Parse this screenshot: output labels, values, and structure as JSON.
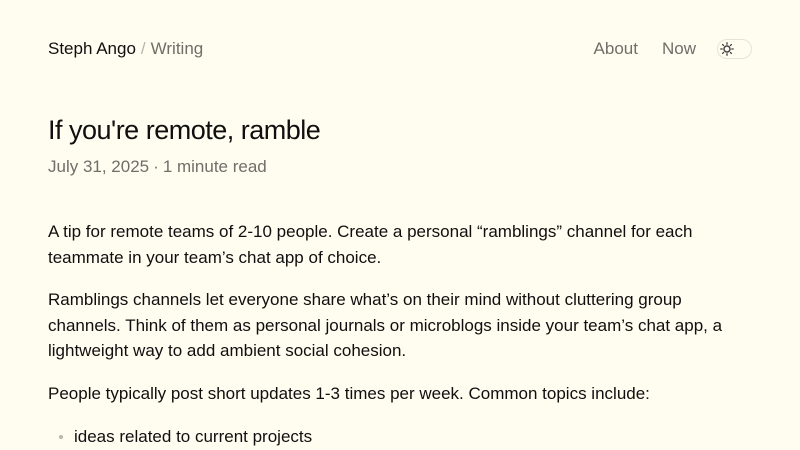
{
  "header": {
    "site_name": "Steph Ango",
    "separator": "/",
    "section": "Writing",
    "nav": [
      {
        "label": "About"
      },
      {
        "label": "Now"
      }
    ],
    "theme_toggle_icon": "sun-icon"
  },
  "article": {
    "title": "If you're remote, ramble",
    "date": "July 31, 2025",
    "meta_separator": "·",
    "read_time": "1 minute read",
    "paragraphs": [
      "A tip for remote teams of 2-10 people. Create a personal “ramblings” channel for each teammate in your team’s chat app of choice.",
      "Ramblings channels let everyone share what’s on their mind without cluttering group channels. Think of them as personal journals or microblogs inside your team’s chat app, a lightweight way to add ambient social cohesion.",
      "People typically post short updates 1-3 times per week. Common topics include:"
    ],
    "list": [
      "ideas related to current projects"
    ]
  },
  "colors": {
    "background": "#fffcf0",
    "text": "#100f0f",
    "muted": "#6f6e69",
    "border": "#e6e4d9"
  }
}
